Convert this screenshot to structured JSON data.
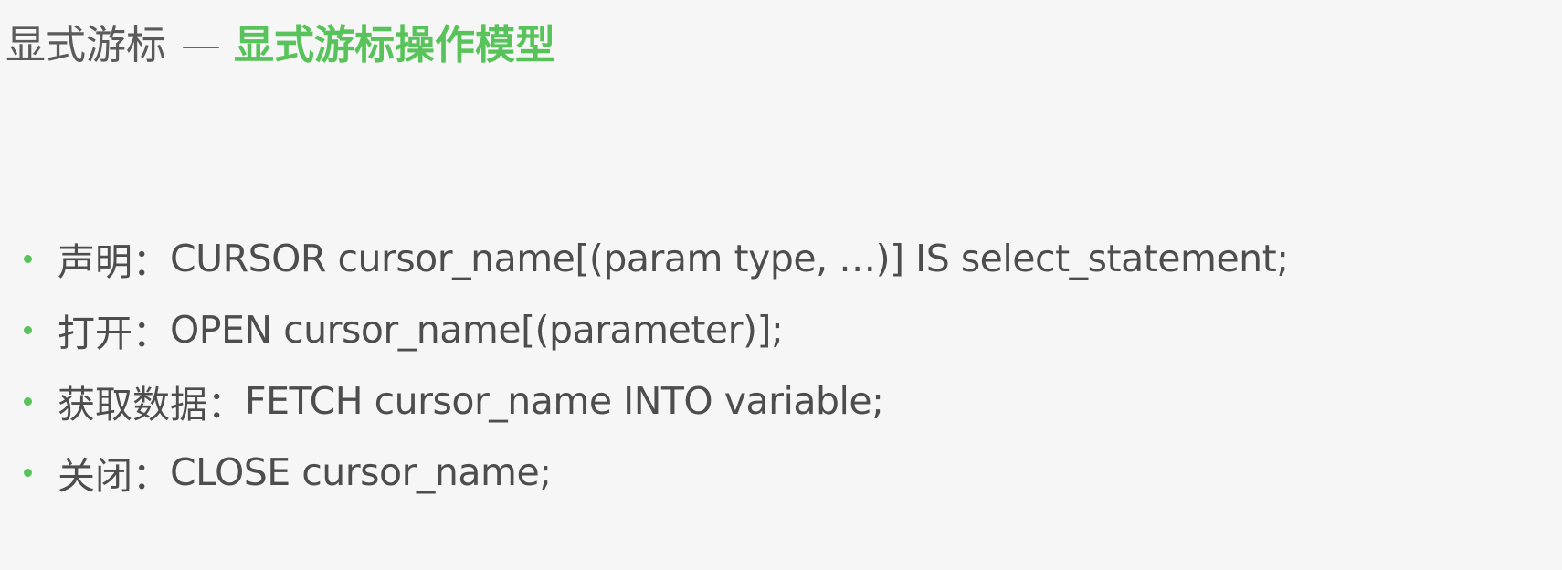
{
  "title": {
    "prefix": "显式游标",
    "separator": "—",
    "emphasis": "显式游标操作模型"
  },
  "bullets": [
    {
      "label": "声明：",
      "code": "CURSOR cursor_name[(param type, …)]  IS  select_statement;"
    },
    {
      "label": "打开：",
      "code": " OPEN cursor_name[(parameter)];"
    },
    {
      "label": "获取数据：",
      "code": "FETCH cursor_name INTO variable;"
    },
    {
      "label": "关闭：",
      "code": "CLOSE cursor_name;"
    }
  ],
  "colors": {
    "accent": "#58c35a",
    "text": "#4d4d4d",
    "background": "#f6f6f6"
  }
}
